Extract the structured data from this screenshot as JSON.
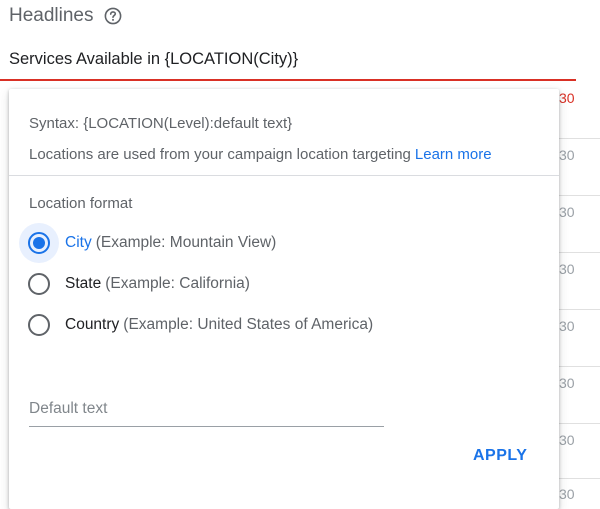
{
  "headlines": {
    "title": "Headlines",
    "help_icon": "help-circle-icon",
    "field_value": "Services Available in {LOCATION(City)}",
    "error_color": "#d93025",
    "counters": [
      "30",
      "30",
      "30",
      "30",
      "30",
      "30",
      "30",
      "30"
    ]
  },
  "popover": {
    "syntax": "Syntax: {LOCATION(Level):default text}",
    "locations_info": "Locations are used from your campaign location targeting",
    "learn_more": "Learn more",
    "format_label": "Location format",
    "options": [
      {
        "name": "City",
        "example": "(Example: Mountain View)",
        "selected": true
      },
      {
        "name": "State",
        "example": "(Example: California)",
        "selected": false
      },
      {
        "name": "Country",
        "example": "(Example: United States of America)",
        "selected": false
      }
    ],
    "default_text_placeholder": "Default text",
    "apply_label": "APPLY"
  },
  "colors": {
    "accent": "#1a73e8",
    "text_secondary": "#5f6368"
  }
}
